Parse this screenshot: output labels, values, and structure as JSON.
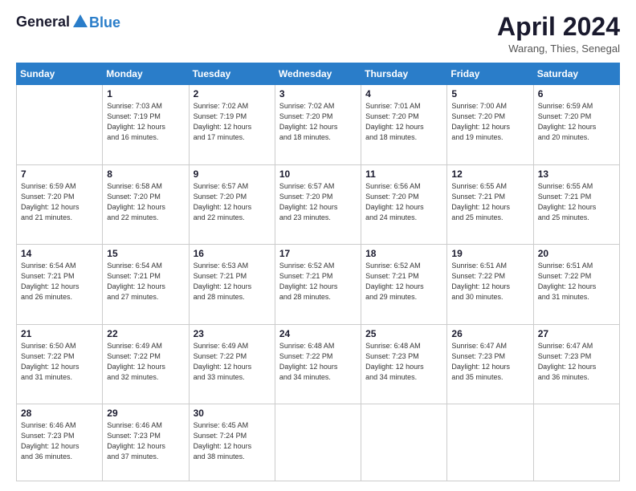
{
  "header": {
    "logo_line1": "General",
    "logo_line2": "Blue",
    "month": "April 2024",
    "location": "Warang, Thies, Senegal"
  },
  "days_of_week": [
    "Sunday",
    "Monday",
    "Tuesday",
    "Wednesday",
    "Thursday",
    "Friday",
    "Saturday"
  ],
  "weeks": [
    [
      {
        "date": "",
        "info": ""
      },
      {
        "date": "1",
        "info": "Sunrise: 7:03 AM\nSunset: 7:19 PM\nDaylight: 12 hours\nand 16 minutes."
      },
      {
        "date": "2",
        "info": "Sunrise: 7:02 AM\nSunset: 7:19 PM\nDaylight: 12 hours\nand 17 minutes."
      },
      {
        "date": "3",
        "info": "Sunrise: 7:02 AM\nSunset: 7:20 PM\nDaylight: 12 hours\nand 18 minutes."
      },
      {
        "date": "4",
        "info": "Sunrise: 7:01 AM\nSunset: 7:20 PM\nDaylight: 12 hours\nand 18 minutes."
      },
      {
        "date": "5",
        "info": "Sunrise: 7:00 AM\nSunset: 7:20 PM\nDaylight: 12 hours\nand 19 minutes."
      },
      {
        "date": "6",
        "info": "Sunrise: 6:59 AM\nSunset: 7:20 PM\nDaylight: 12 hours\nand 20 minutes."
      }
    ],
    [
      {
        "date": "7",
        "info": "Sunrise: 6:59 AM\nSunset: 7:20 PM\nDaylight: 12 hours\nand 21 minutes."
      },
      {
        "date": "8",
        "info": "Sunrise: 6:58 AM\nSunset: 7:20 PM\nDaylight: 12 hours\nand 22 minutes."
      },
      {
        "date": "9",
        "info": "Sunrise: 6:57 AM\nSunset: 7:20 PM\nDaylight: 12 hours\nand 22 minutes."
      },
      {
        "date": "10",
        "info": "Sunrise: 6:57 AM\nSunset: 7:20 PM\nDaylight: 12 hours\nand 23 minutes."
      },
      {
        "date": "11",
        "info": "Sunrise: 6:56 AM\nSunset: 7:20 PM\nDaylight: 12 hours\nand 24 minutes."
      },
      {
        "date": "12",
        "info": "Sunrise: 6:55 AM\nSunset: 7:21 PM\nDaylight: 12 hours\nand 25 minutes."
      },
      {
        "date": "13",
        "info": "Sunrise: 6:55 AM\nSunset: 7:21 PM\nDaylight: 12 hours\nand 25 minutes."
      }
    ],
    [
      {
        "date": "14",
        "info": "Sunrise: 6:54 AM\nSunset: 7:21 PM\nDaylight: 12 hours\nand 26 minutes."
      },
      {
        "date": "15",
        "info": "Sunrise: 6:54 AM\nSunset: 7:21 PM\nDaylight: 12 hours\nand 27 minutes."
      },
      {
        "date": "16",
        "info": "Sunrise: 6:53 AM\nSunset: 7:21 PM\nDaylight: 12 hours\nand 28 minutes."
      },
      {
        "date": "17",
        "info": "Sunrise: 6:52 AM\nSunset: 7:21 PM\nDaylight: 12 hours\nand 28 minutes."
      },
      {
        "date": "18",
        "info": "Sunrise: 6:52 AM\nSunset: 7:21 PM\nDaylight: 12 hours\nand 29 minutes."
      },
      {
        "date": "19",
        "info": "Sunrise: 6:51 AM\nSunset: 7:22 PM\nDaylight: 12 hours\nand 30 minutes."
      },
      {
        "date": "20",
        "info": "Sunrise: 6:51 AM\nSunset: 7:22 PM\nDaylight: 12 hours\nand 31 minutes."
      }
    ],
    [
      {
        "date": "21",
        "info": "Sunrise: 6:50 AM\nSunset: 7:22 PM\nDaylight: 12 hours\nand 31 minutes."
      },
      {
        "date": "22",
        "info": "Sunrise: 6:49 AM\nSunset: 7:22 PM\nDaylight: 12 hours\nand 32 minutes."
      },
      {
        "date": "23",
        "info": "Sunrise: 6:49 AM\nSunset: 7:22 PM\nDaylight: 12 hours\nand 33 minutes."
      },
      {
        "date": "24",
        "info": "Sunrise: 6:48 AM\nSunset: 7:22 PM\nDaylight: 12 hours\nand 34 minutes."
      },
      {
        "date": "25",
        "info": "Sunrise: 6:48 AM\nSunset: 7:23 PM\nDaylight: 12 hours\nand 34 minutes."
      },
      {
        "date": "26",
        "info": "Sunrise: 6:47 AM\nSunset: 7:23 PM\nDaylight: 12 hours\nand 35 minutes."
      },
      {
        "date": "27",
        "info": "Sunrise: 6:47 AM\nSunset: 7:23 PM\nDaylight: 12 hours\nand 36 minutes."
      }
    ],
    [
      {
        "date": "28",
        "info": "Sunrise: 6:46 AM\nSunset: 7:23 PM\nDaylight: 12 hours\nand 36 minutes."
      },
      {
        "date": "29",
        "info": "Sunrise: 6:46 AM\nSunset: 7:23 PM\nDaylight: 12 hours\nand 37 minutes."
      },
      {
        "date": "30",
        "info": "Sunrise: 6:45 AM\nSunset: 7:24 PM\nDaylight: 12 hours\nand 38 minutes."
      },
      {
        "date": "",
        "info": ""
      },
      {
        "date": "",
        "info": ""
      },
      {
        "date": "",
        "info": ""
      },
      {
        "date": "",
        "info": ""
      }
    ]
  ]
}
